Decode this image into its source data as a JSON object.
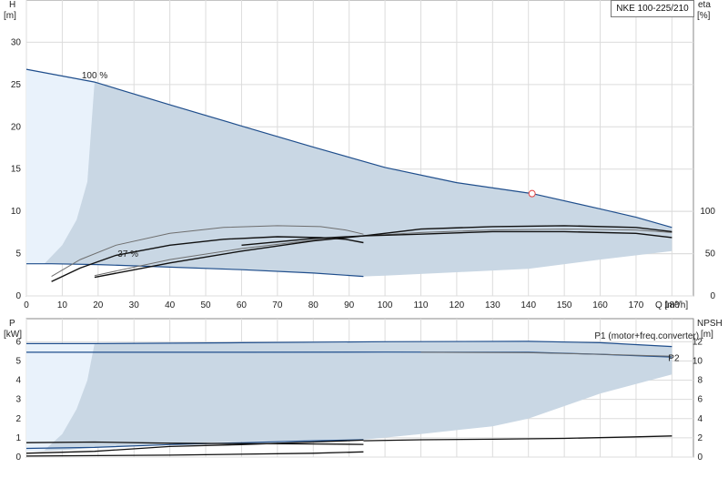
{
  "title": "NKE 100-225/210",
  "colors": {
    "band_fill": "#c9d7e4",
    "band_light": "#e9f2fb",
    "blue_line": "#1f4e8c",
    "curve_black": "#111111",
    "curve_gray": "#6e6e6e",
    "grid": "#dcdcdc",
    "marker": "#e04040"
  },
  "chart_data": [
    {
      "type": "line",
      "name": "head-efficiency",
      "y_label_left": "H",
      "y_unit_left": "[m]",
      "y_label_right": "eta",
      "y_unit_right": "[%]",
      "x_label": "Q [m³/h]",
      "xlim": [
        0,
        186
      ],
      "ylim": [
        0,
        35
      ],
      "eta_lim": [
        0,
        350
      ],
      "grid": true,
      "x_ticks": [
        "0",
        "10",
        "20",
        "30",
        "40",
        "50",
        "60",
        "70",
        "80",
        "90",
        "100",
        "110",
        "120",
        "130",
        "140",
        "150",
        "160",
        "170",
        "180"
      ],
      "y_ticks": [
        "0",
        "5",
        "10",
        "15",
        "20",
        "25",
        "30"
      ],
      "eta_ticks": [
        "0",
        "50",
        "100"
      ],
      "annotations": [
        {
          "text": "100 %",
          "x": 19,
          "y": 25.3
        },
        {
          "text": "37 %",
          "x": 29,
          "y": 4.2
        }
      ],
      "operating_point": {
        "x": 141,
        "y": 12.1
      },
      "band_upper": [
        [
          0,
          26.8
        ],
        [
          19,
          25.3
        ],
        [
          40,
          22.6
        ],
        [
          60,
          20.1
        ],
        [
          80,
          17.6
        ],
        [
          100,
          15.2
        ],
        [
          120,
          13.4
        ],
        [
          141,
          12.1
        ],
        [
          160,
          10.3
        ],
        [
          170,
          9.3
        ],
        [
          180,
          8.1
        ]
      ],
      "band_lower": [
        [
          0,
          3.8
        ],
        [
          7,
          3.8
        ],
        [
          20,
          3.7
        ],
        [
          40,
          3.4
        ],
        [
          60,
          3.1
        ],
        [
          80,
          2.7
        ],
        [
          94,
          2.3
        ],
        [
          100,
          2.4
        ],
        [
          120,
          2.8
        ],
        [
          140,
          3.2
        ],
        [
          160,
          4.3
        ],
        [
          180,
          5.3
        ]
      ],
      "efficiency_envelope": [
        [
          0,
          3.8
        ],
        [
          5,
          3.8
        ],
        [
          10,
          6
        ],
        [
          14,
          9
        ],
        [
          17,
          13.5
        ],
        [
          19,
          25.3
        ]
      ],
      "series": [
        {
          "style": "head_max_line",
          "values": [
            [
              0,
              26.8
            ],
            [
              19,
              25.3
            ],
            [
              40,
              22.6
            ],
            [
              60,
              20.1
            ],
            [
              80,
              17.6
            ],
            [
              100,
              15.2
            ],
            [
              120,
              13.4
            ],
            [
              141,
              12.1
            ],
            [
              160,
              10.3
            ],
            [
              170,
              9.3
            ],
            [
              180,
              8.1
            ]
          ]
        },
        {
          "style": "head_min_line",
          "values": [
            [
              0,
              3.8
            ],
            [
              7,
              3.8
            ],
            [
              20,
              3.7
            ],
            [
              40,
              3.4
            ],
            [
              60,
              3.1
            ],
            [
              80,
              2.7
            ],
            [
              94,
              2.3
            ]
          ]
        },
        {
          "style": "eta_gray",
          "values": [
            [
              7,
              2.3
            ],
            [
              15,
              4.3
            ],
            [
              25,
              6
            ],
            [
              40,
              7.4
            ],
            [
              55,
              8.1
            ],
            [
              70,
              8.3
            ],
            [
              82,
              8.2
            ],
            [
              89,
              7.8
            ],
            [
              94,
              7.3
            ]
          ]
        },
        {
          "style": "eta_black",
          "values": [
            [
              7,
              1.7
            ],
            [
              15,
              3.3
            ],
            [
              25,
              4.8
            ],
            [
              40,
              6
            ],
            [
              55,
              6.7
            ],
            [
              70,
              7
            ],
            [
              82,
              6.9
            ],
            [
              89,
              6.7
            ],
            [
              94,
              6.3
            ]
          ]
        },
        {
          "style": "eta_gray",
          "values": [
            [
              19,
              2.4
            ],
            [
              40,
              4.3
            ],
            [
              60,
              5.6
            ],
            [
              80,
              6.6
            ],
            [
              94,
              7.1
            ],
            [
              110,
              7.5
            ],
            [
              130,
              7.8
            ],
            [
              150,
              7.9
            ],
            [
              170,
              7.8
            ],
            [
              180,
              7.5
            ]
          ]
        },
        {
          "style": "eta_black",
          "values": [
            [
              19,
              2.2
            ],
            [
              40,
              3.9
            ],
            [
              60,
              5.3
            ],
            [
              80,
              6.5
            ],
            [
              94,
              7.1
            ],
            [
              110,
              7.9
            ],
            [
              130,
              8.2
            ],
            [
              150,
              8.3
            ],
            [
              170,
              8.1
            ],
            [
              180,
              7.6
            ]
          ]
        },
        {
          "style": "eta_black",
          "values": [
            [
              60,
              6
            ],
            [
              80,
              6.8
            ],
            [
              94,
              7.1
            ],
            [
              110,
              7.3
            ],
            [
              130,
              7.6
            ],
            [
              150,
              7.6
            ],
            [
              170,
              7.4
            ],
            [
              180,
              6.9
            ]
          ]
        }
      ]
    },
    {
      "type": "line",
      "name": "power-npsh",
      "y_label_left": "P",
      "y_unit_left": "[kW]",
      "y_label_right": "NPSH",
      "y_unit_right": "[m]",
      "xlim": [
        0,
        186
      ],
      "ylim": [
        0,
        7.2
      ],
      "npsh_lim": [
        0,
        14.4
      ],
      "grid": true,
      "y_ticks": [
        "0",
        "1",
        "2",
        "3",
        "4",
        "5",
        "6"
      ],
      "npsh_ticks": [
        "0",
        "2",
        "4",
        "6",
        "8",
        "10",
        "12"
      ],
      "annotations": [
        {
          "text": "P1 (motor+freq.converter)",
          "x": 173,
          "y": 6.15
        },
        {
          "text": "P2",
          "x": 181,
          "y": 5.0
        }
      ],
      "band_upper": [
        [
          0,
          5.9
        ],
        [
          19,
          5.9
        ],
        [
          60,
          5.93
        ],
        [
          100,
          5.97
        ],
        [
          140,
          6.02
        ],
        [
          160,
          5.95
        ],
        [
          180,
          5.75
        ]
      ],
      "band_lower": [
        [
          0,
          0.3
        ],
        [
          10,
          0.35
        ],
        [
          20,
          0.5
        ],
        [
          40,
          0.7
        ],
        [
          60,
          0.8
        ],
        [
          80,
          0.85
        ],
        [
          94,
          0.9
        ],
        [
          110,
          1.2
        ],
        [
          130,
          1.6
        ],
        [
          140,
          2.0
        ],
        [
          160,
          3.3
        ],
        [
          180,
          4.3
        ]
      ],
      "efficiency_envelope": [
        [
          0,
          0.3
        ],
        [
          5,
          0.35
        ],
        [
          10,
          1.2
        ],
        [
          14,
          2.5
        ],
        [
          17,
          4
        ],
        [
          19,
          5.9
        ]
      ],
      "series": [
        {
          "style": "P1_blue",
          "values": [
            [
              0,
              5.9
            ],
            [
              19,
              5.9
            ],
            [
              60,
              5.95
            ],
            [
              100,
              6
            ],
            [
              140,
              6.02
            ],
            [
              160,
              5.95
            ],
            [
              180,
              5.75
            ]
          ]
        },
        {
          "style": "P2_blue",
          "values": [
            [
              0,
              5.45
            ],
            [
              19,
              5.45
            ],
            [
              60,
              5.45
            ],
            [
              100,
              5.46
            ],
            [
              140,
              5.45
            ],
            [
              160,
              5.35
            ],
            [
              180,
              5.2
            ]
          ]
        },
        {
          "style": "P2_gray",
          "values": [
            [
              110,
              5.45
            ],
            [
              140,
              5.43
            ],
            [
              160,
              5.35
            ],
            [
              180,
              5.25
            ]
          ]
        },
        {
          "style": "low_blue",
          "values": [
            [
              0,
              0.45
            ],
            [
              19,
              0.5
            ],
            [
              40,
              0.65
            ],
            [
              60,
              0.75
            ],
            [
              80,
              0.85
            ],
            [
              94,
              0.9
            ]
          ]
        },
        {
          "style": "low_black",
          "values": [
            [
              0,
              0.2
            ],
            [
              19,
              0.3
            ],
            [
              40,
              0.55
            ],
            [
              60,
              0.65
            ],
            [
              80,
              0.78
            ],
            [
              94,
              0.88
            ]
          ]
        },
        {
          "style": "low_black",
          "values": [
            [
              0,
              0.75
            ],
            [
              19,
              0.78
            ],
            [
              40,
              0.72
            ],
            [
              60,
              0.7
            ],
            [
              80,
              0.68
            ],
            [
              94,
              0.66
            ]
          ]
        },
        {
          "style": "npsh_black",
          "values": [
            [
              94,
              0.85
            ],
            [
              110,
              0.9
            ],
            [
              130,
              0.93
            ],
            [
              150,
              0.97
            ],
            [
              170,
              1.05
            ],
            [
              180,
              1.1
            ]
          ]
        },
        {
          "style": "low_black",
          "values": [
            [
              0,
              0.05
            ],
            [
              40,
              0.1
            ],
            [
              80,
              0.2
            ],
            [
              94,
              0.27
            ]
          ]
        }
      ]
    }
  ]
}
